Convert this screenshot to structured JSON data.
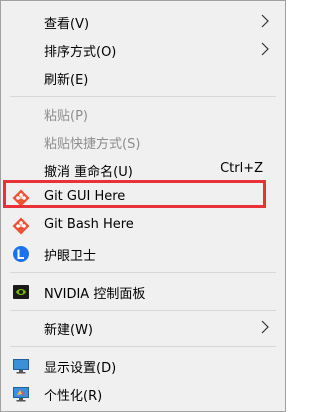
{
  "menu": {
    "view": {
      "label": "查看(V)"
    },
    "sort": {
      "label": "排序方式(O)"
    },
    "refresh": {
      "label": "刷新(E)"
    },
    "paste": {
      "label": "粘贴(P)"
    },
    "paste_shortcut": {
      "label": "粘贴快捷方式(S)"
    },
    "undo": {
      "label": "撤消 重命名(U)",
      "shortcut": "Ctrl+Z"
    },
    "git_gui": {
      "label": "Git GUI Here",
      "icon": "git-gui-icon"
    },
    "git_bash": {
      "label": "Git Bash Here",
      "icon": "git-bash-icon"
    },
    "eye_guard": {
      "label": "护眼卫士",
      "icon": "eye-guard-icon"
    },
    "nvidia": {
      "label": "NVIDIA 控制面板",
      "icon": "nvidia-icon"
    },
    "new": {
      "label": "新建(W)"
    },
    "display": {
      "label": "显示设置(D)",
      "icon": "display-icon"
    },
    "personalize": {
      "label": "个性化(R)",
      "icon": "personalize-icon"
    }
  },
  "colors": {
    "menu_bg": "#f0f0f0",
    "disabled_text": "#8d8d8d",
    "highlight_border": "#e8323a",
    "git_orange": "#f05033",
    "eye_blue": "#1a73e8",
    "nvidia_green": "#76b900"
  }
}
